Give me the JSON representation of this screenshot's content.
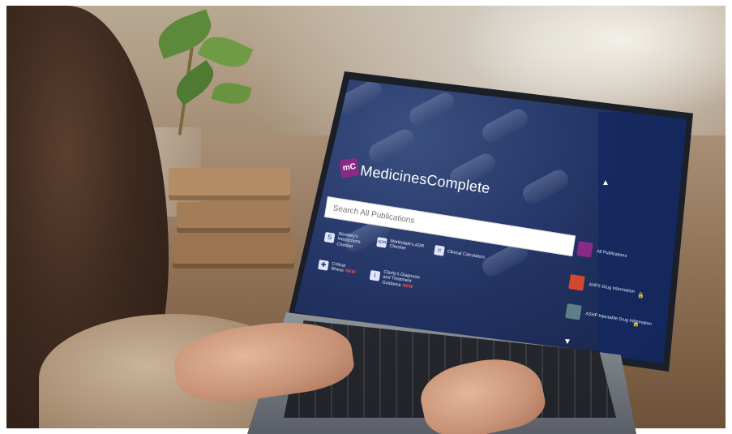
{
  "brand": {
    "logo_letters": "mC",
    "name": "MedicinesComplete"
  },
  "search": {
    "placeholder": "Search All Publications"
  },
  "tools": [
    {
      "icon": "S",
      "label": "Stockley's Interactions Checker"
    },
    {
      "icon": "ADR",
      "label": "Martindale's ADR Checker"
    },
    {
      "icon": "⌗",
      "label": "Clinical Calculators"
    },
    {
      "icon": "✚",
      "label": "Critical Illness",
      "badge": "NEW"
    },
    {
      "icon": "i",
      "label": "Clarity's Diagnosis and Treatment Guidance",
      "badge": "NEW"
    }
  ],
  "publications": [
    {
      "label": "All Publications",
      "thumb_color": "#8b2a86"
    },
    {
      "label": "AHFS Drug Information",
      "thumb_color": "#d24a2b"
    },
    {
      "label": "ASHP Injectable Drug Information",
      "thumb_color": "#5d7f86"
    }
  ],
  "nav": {
    "up_arrow": "▲",
    "down_arrow": "▼"
  }
}
